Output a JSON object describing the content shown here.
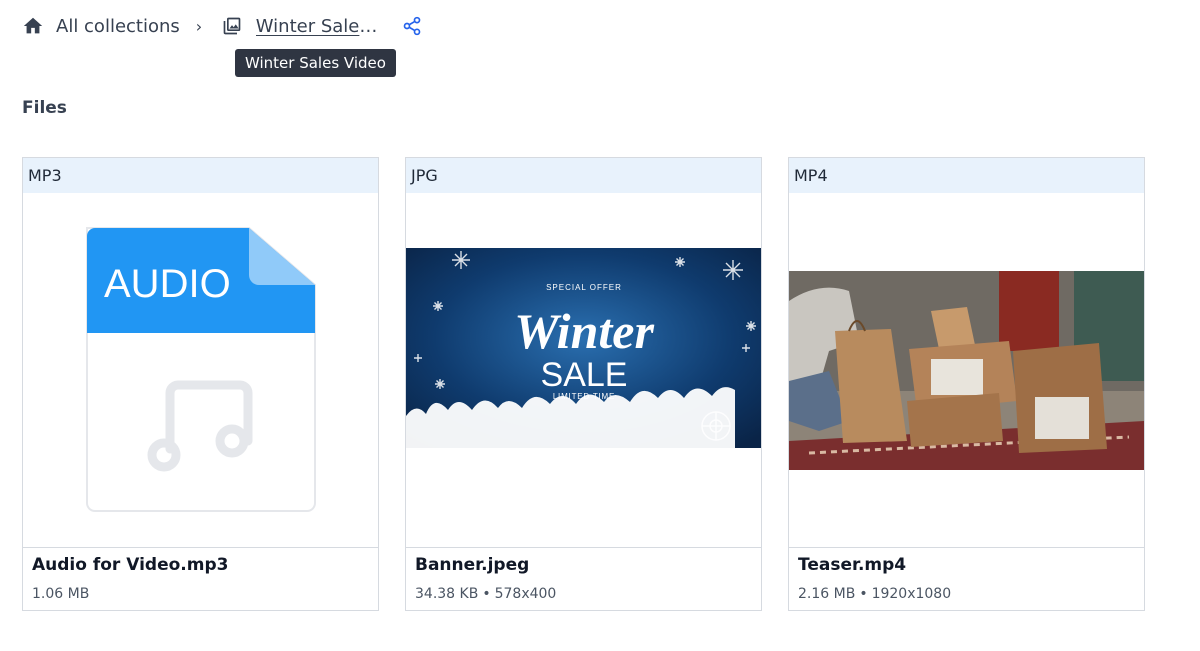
{
  "breadcrumb": {
    "home_label": "All collections",
    "separator": "›",
    "current_label": "Winter Sales Video"
  },
  "tooltip": {
    "text": "Winter Sales Video"
  },
  "section": {
    "title": "Files"
  },
  "icons": {
    "home": "home-icon",
    "collection": "image-collection-icon",
    "share": "share-icon",
    "audio_file": "audio-file-icon",
    "music_note": "music-note-icon"
  },
  "colors": {
    "accent": "#2563eb",
    "type_header": "#e8f2fc",
    "tooltip_bg": "#2f3542",
    "audio_band": "#2196f3"
  },
  "files": [
    {
      "type": "MP3",
      "name": "Audio for Video.mp3",
      "size": "1.06 MB",
      "dimensions": null,
      "preview": {
        "kind": "audio-icon",
        "label": "AUDIO"
      }
    },
    {
      "type": "JPG",
      "name": "Banner.jpeg",
      "size": "34.38 KB",
      "dimensions": "578x400",
      "preview": {
        "kind": "image",
        "top_text": "SPECIAL OFFER",
        "script_text": "Winter",
        "main_text": "SALE",
        "bottom_text": "LIMITED TIME"
      }
    },
    {
      "type": "MP4",
      "name": "Teaser.mp4",
      "size": "2.16 MB",
      "dimensions": "1920x1080",
      "preview": {
        "kind": "video-thumbnail"
      }
    }
  ]
}
